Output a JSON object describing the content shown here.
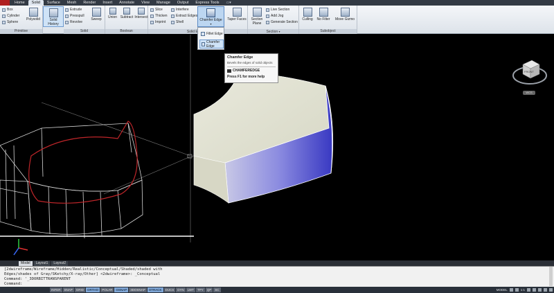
{
  "ribbon_tabs": [
    "Home",
    "Solid",
    "Surface",
    "Mesh",
    "Render",
    "Insert",
    "Annotate",
    "View",
    "Manage",
    "Output",
    "Express Tools"
  ],
  "active_tab": "Solid",
  "panels": {
    "primitive": {
      "title": "Primitive",
      "items": [
        "Box",
        "Cylinder",
        "Sphere"
      ],
      "big": "Polysolid"
    },
    "history": {
      "label": "Solid History"
    },
    "solid": {
      "title": "Solid",
      "items": [
        "Extrude",
        "Presspull",
        "Revolve"
      ],
      "big": "Sweep"
    },
    "boolean": {
      "title": "Boolean",
      "items": [
        "Union",
        "Subtract",
        "Intersect"
      ]
    },
    "solid_editing": {
      "title": "Solid Editing",
      "col1": [
        "Slice",
        "Thicken",
        "Imprint"
      ],
      "col2": [
        "Interfere",
        "Extract Edges",
        "Shell"
      ],
      "chamfer": "Chamfer Edge",
      "taper": "Taper Faces"
    },
    "section": {
      "title": "Section",
      "big": "Section Plane",
      "items": [
        "Live Section",
        "Add Jog",
        "Generate Section"
      ]
    },
    "subobject": {
      "title": "Subobject",
      "items": [
        "Culling",
        "No Filter",
        "Move Gizmo"
      ]
    }
  },
  "dropdown": {
    "items": [
      "Fillet Edge",
      "Chamfer Edge"
    ]
  },
  "tooltip": {
    "title": "Chamfer Edge",
    "description": "Bevels the edges of solid objects",
    "command": "CHAMFEREDGE",
    "help": "Press F1 for more help"
  },
  "viewcube": {
    "face": "FRONT",
    "wcs": "WCS"
  },
  "layout_tabs": [
    "Model",
    "Layout1",
    "Layout2"
  ],
  "active_layout": "Model",
  "command_history": [
    "[2dwireframe/Wireframe/Hidden/Realistic/Conceptual/Shaded/shaded with",
    "Edges/shades of Gray/SKetchy/X-ray/Other] <2dwireframe>: _Conceptual",
    "Command: '_3DORBITTRANSPARENT",
    "Command:"
  ],
  "status_toggles": [
    {
      "label": "INFER",
      "on": false
    },
    {
      "label": "SNAP",
      "on": false
    },
    {
      "label": "GRID",
      "on": false
    },
    {
      "label": "ORTHO",
      "on": true
    },
    {
      "label": "POLAR",
      "on": false
    },
    {
      "label": "OSNAP",
      "on": true
    },
    {
      "label": "3DOSNAP",
      "on": false
    },
    {
      "label": "OTRACK",
      "on": true
    },
    {
      "label": "DUCS",
      "on": false
    },
    {
      "label": "DYN",
      "on": false
    },
    {
      "label": "LWT",
      "on": false
    },
    {
      "label": "TPY",
      "on": false
    },
    {
      "label": "QP",
      "on": false
    },
    {
      "label": "SC",
      "on": false
    }
  ],
  "status_right": {
    "model": "MODEL",
    "scale": "1:1"
  },
  "colors": {
    "solid_face_top": "#e3e4d5",
    "solid_face_side": "#5a5acf",
    "wire_red": "#c0262a",
    "ucs_green": "#2ecc40",
    "ucs_blue": "#3a6cff"
  }
}
